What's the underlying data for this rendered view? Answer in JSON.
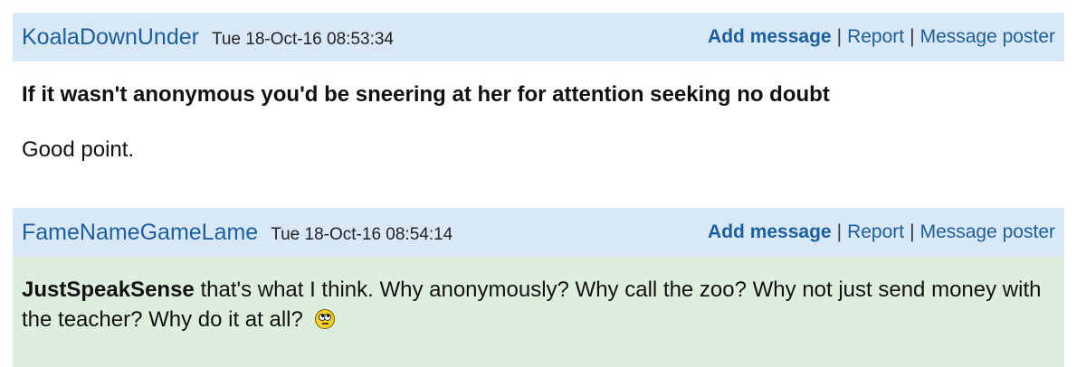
{
  "posts": [
    {
      "username": "KoalaDownUnder",
      "timestamp": "Tue 18-Oct-16 08:53:34",
      "actions": {
        "add": "Add message",
        "report": "Report",
        "poster": "Message poster"
      },
      "quote": "If it wasn't anonymous you'd be sneering at her for attention seeking no doubt",
      "text": "Good point."
    },
    {
      "username": "FameNameGameLame",
      "timestamp": "Tue 18-Oct-16 08:54:14",
      "actions": {
        "add": "Add message",
        "report": "Report",
        "poster": "Message poster"
      },
      "mention": "JustSpeakSense",
      "text": " that's what I think. Why anonymously? Why call the zoo? Why not just send money with the teacher? Why do it at all?",
      "emoji": "rolling-eyes-smiley-icon"
    }
  ],
  "separator": "|",
  "colors": {
    "header_bg": "#d9e8f7",
    "link": "#1b5fa0",
    "highlight_bg": "#deeedd"
  }
}
